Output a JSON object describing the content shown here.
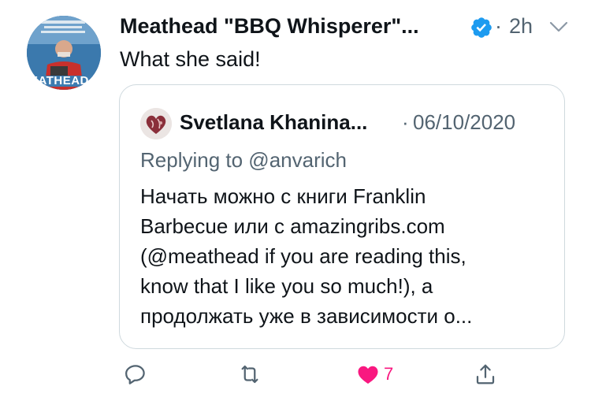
{
  "tweet": {
    "author_name": "Meathead \"BBQ Whisperer\"...",
    "separator": "·",
    "time": "2h",
    "text": "What she said!",
    "avatar_book_title": "EATHEAD"
  },
  "quote": {
    "author_name": "Svetlana Khanina...",
    "separator": "·",
    "date": "06/10/2020",
    "replying_to": "Replying to @anvarich",
    "lines": [
      "Начать можно с книги Franklin",
      "Barbecue или с amazingribs.com",
      "(@meathead if you are reading this,",
      "know that I like you so much!), а",
      "продолжать уже в зависимости о..."
    ]
  },
  "actions": {
    "like_count": "7"
  },
  "colors": {
    "text": "#0f1419",
    "muted": "#536471",
    "verified": "#1d9bf0",
    "like": "#f91880",
    "border": "#cfd9de"
  }
}
